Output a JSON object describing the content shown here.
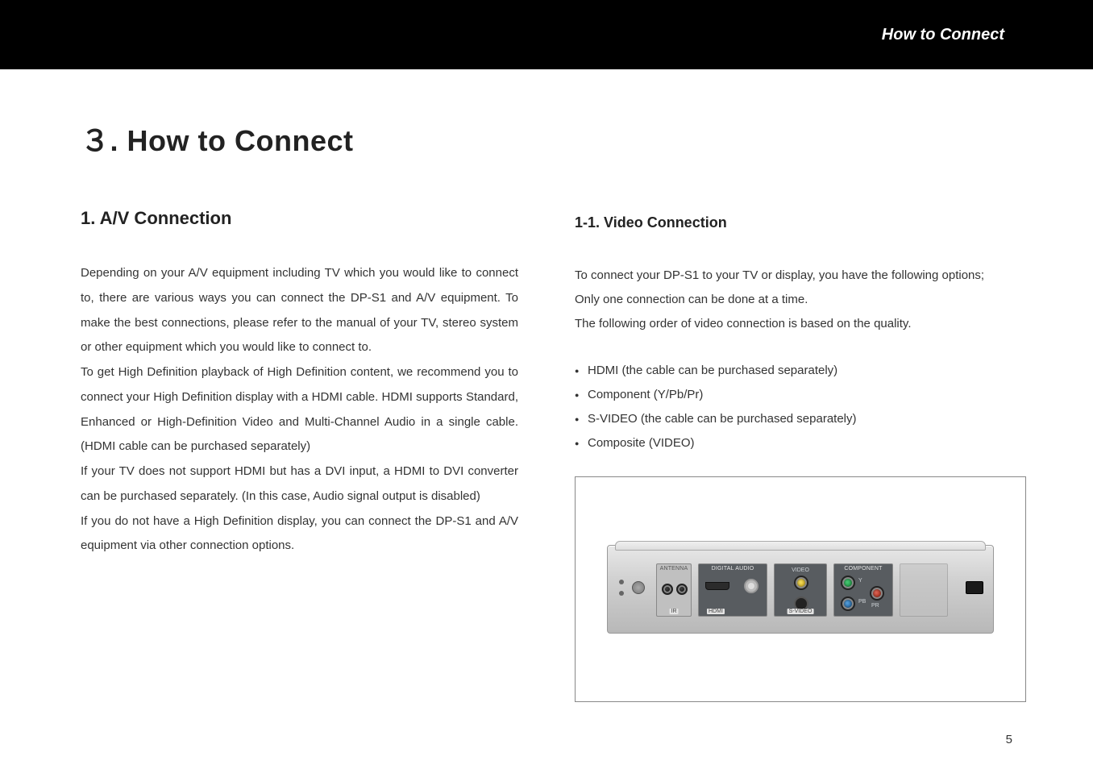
{
  "header": {
    "title": "How to Connect"
  },
  "chapter": {
    "title": "３. How to Connect"
  },
  "left": {
    "heading": "1. A/V Connection",
    "para1": "Depending on your A/V equipment including TV which you would like to connect to, there are various ways you can connect the DP-S1 and A/V equipment. To make the best connections, please refer to the manual of your TV, stereo system or other equipment which you would like to connect to.",
    "para2": "To get High Definition playback of High Definition content, we recommend you to connect your High Definition display with a HDMI cable. HDMI supports Standard, Enhanced or High-Definition Video and Multi-Channel Audio in a single cable. (HDMI cable can be purchased separately)",
    "para3": "If your TV does not support HDMI but has a DVI input, a HDMI to DVI converter can be purchased separately. (In this case, Audio signal output is disabled)",
    "para4": "If you do not have a High Definition display, you can connect the DP-S1 and A/V equipment via other connection options."
  },
  "right": {
    "heading": "1-1. Video Connection",
    "intro1": "To connect your DP-S1 to your TV or display, you have the following options;",
    "intro2": "Only one connection can be done at a time.",
    "intro3": "The following order of video connection is based on the quality.",
    "bullets": [
      "HDMI (the cable can be purchased separately)",
      "Component (Y/Pb/Pr)",
      "S-VIDEO (the cable can be purchased separately)",
      "Composite (VIDEO)"
    ]
  },
  "figure": {
    "labels": {
      "video": "VIDEO",
      "hdmi": "HDMI",
      "svideo": "S-VIDEO",
      "component": "COMPONENT",
      "digital_audio": "DIGITAL AUDIO",
      "y": "Y",
      "pb": "PB",
      "pr": "PR",
      "antenna": "ANTENNA",
      "ir": "IR"
    }
  },
  "page_number": "5"
}
